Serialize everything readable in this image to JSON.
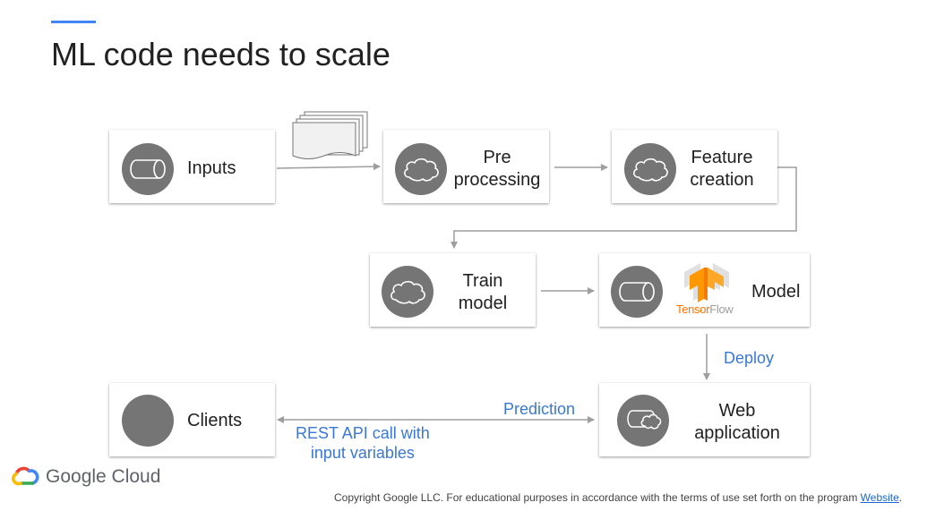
{
  "slide": {
    "title": "ML code needs to scale",
    "accent_color": "#4285f4"
  },
  "nodes": {
    "inputs": {
      "label": "Inputs",
      "icon": "database-cylinder-icon"
    },
    "preprocessing": {
      "line1": "Pre",
      "line2": "processing",
      "icon": "cloud-icon"
    },
    "feature_creation": {
      "line1": "Feature",
      "line2": "creation",
      "icon": "cloud-icon"
    },
    "train_model": {
      "line1": "Train",
      "line2": "model",
      "icon": "cloud-icon"
    },
    "model": {
      "label": "Model",
      "icon": "database-cylinder-icon",
      "logo_text_1": "Tensor",
      "logo_text_2": "Flow"
    },
    "web_application": {
      "line1": "Web",
      "line2": "application",
      "icon": "cylinder-cloud-icon"
    },
    "clients": {
      "label": "Clients",
      "icon": "client-circle-icon"
    }
  },
  "edge_labels": {
    "deploy": "Deploy",
    "prediction": "Prediction",
    "rest_line1": "REST API call with",
    "rest_line2": "input variables"
  },
  "colors": {
    "icon_circle": "#757575",
    "edge_label": "#3a78d4",
    "arrow": "#9e9e9e",
    "tensorflow_orange": "#ff8f00"
  },
  "branding": {
    "logo_text": "Google Cloud"
  },
  "footer": {
    "copyright": "Copyright Google LLC. For educational purposes in accordance with the terms of use set forth on the program ",
    "link_text": "Website",
    "end": "."
  }
}
